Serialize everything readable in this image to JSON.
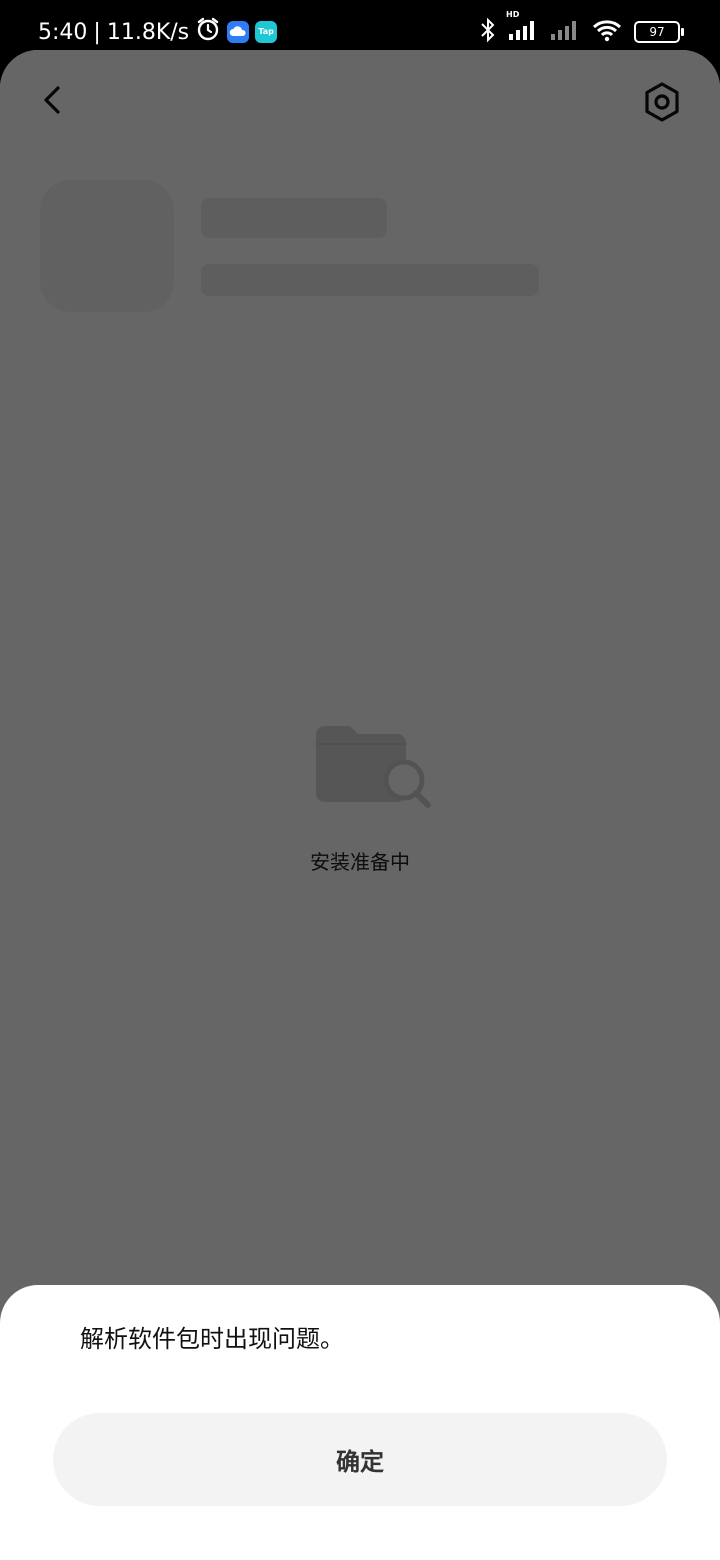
{
  "status_bar": {
    "time": "5:40",
    "separator": "|",
    "network_speed": "11.8K/s",
    "left_icons": [
      "alarm-icon",
      "cloud-app-icon",
      "taptap-app-icon"
    ],
    "taptap_label": "Tap",
    "hd_label": "HD",
    "right_icons": [
      "bluetooth-icon",
      "signal-hd-icon",
      "signal-icon",
      "wifi-icon",
      "battery-icon"
    ],
    "battery_level": "97"
  },
  "header": {
    "back_icon": "chevron-left-icon",
    "settings_icon": "hexagon-settings-icon"
  },
  "main": {
    "illustration_icon": "folder-search-icon",
    "status_text": "安装准备中"
  },
  "dialog": {
    "message": "解析软件包时出现问题。",
    "confirm_label": "确定"
  },
  "colors": {
    "dim_overlay": "#000000",
    "dialog_bg": "#ffffff",
    "button_bg": "#f3f3f3",
    "taptap_accent": "#1fc6d4",
    "cloud_accent": "#2f7df6"
  }
}
